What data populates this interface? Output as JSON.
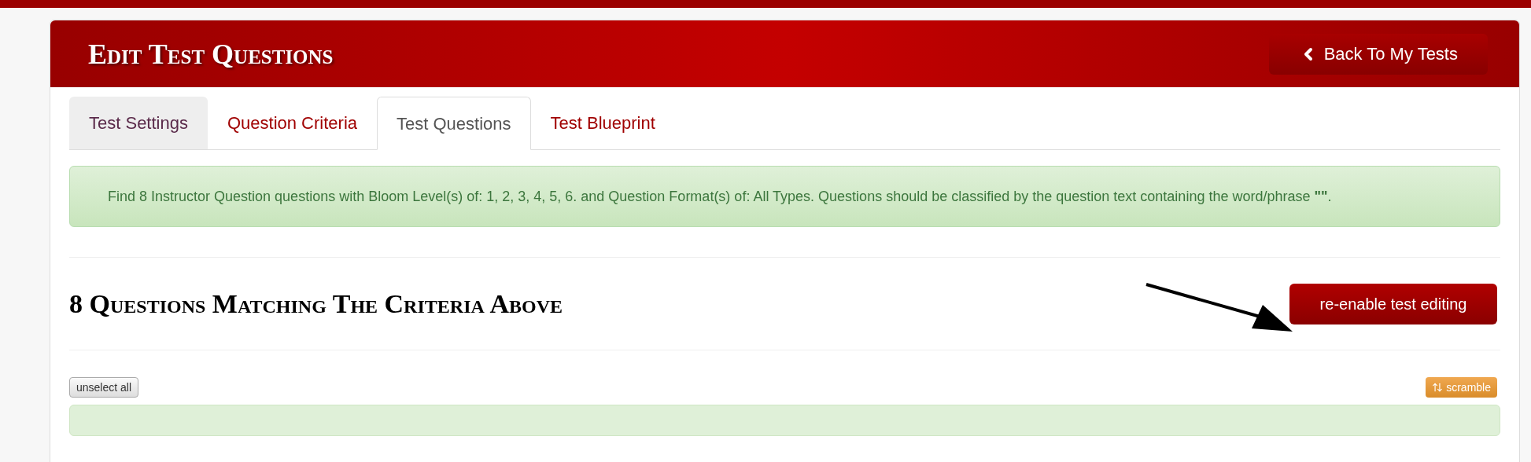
{
  "header": {
    "title": "Edit Test Questions",
    "back_button": "Back To My Tests"
  },
  "tabs": [
    {
      "label": "Test Settings",
      "selected": false,
      "disabled": true
    },
    {
      "label": "Question Criteria",
      "selected": false,
      "disabled": false
    },
    {
      "label": "Test Questions",
      "selected": true,
      "disabled": false
    },
    {
      "label": "Test Blueprint",
      "selected": false,
      "disabled": false
    }
  ],
  "criteria_alert": "Find 8 Instructor Question questions with Bloom Level(s) of: 1, 2, 3, 4, 5, 6. and Question Format(s) of: All Types.  Questions should be classified by the question text containing the word/phrase **\"\"**.",
  "results": {
    "heading": "8 Questions Matching The Criteria Above",
    "reenable_button": "re-enable test editing",
    "unselect_button": "unselect all",
    "scramble_button": "scramble"
  }
}
